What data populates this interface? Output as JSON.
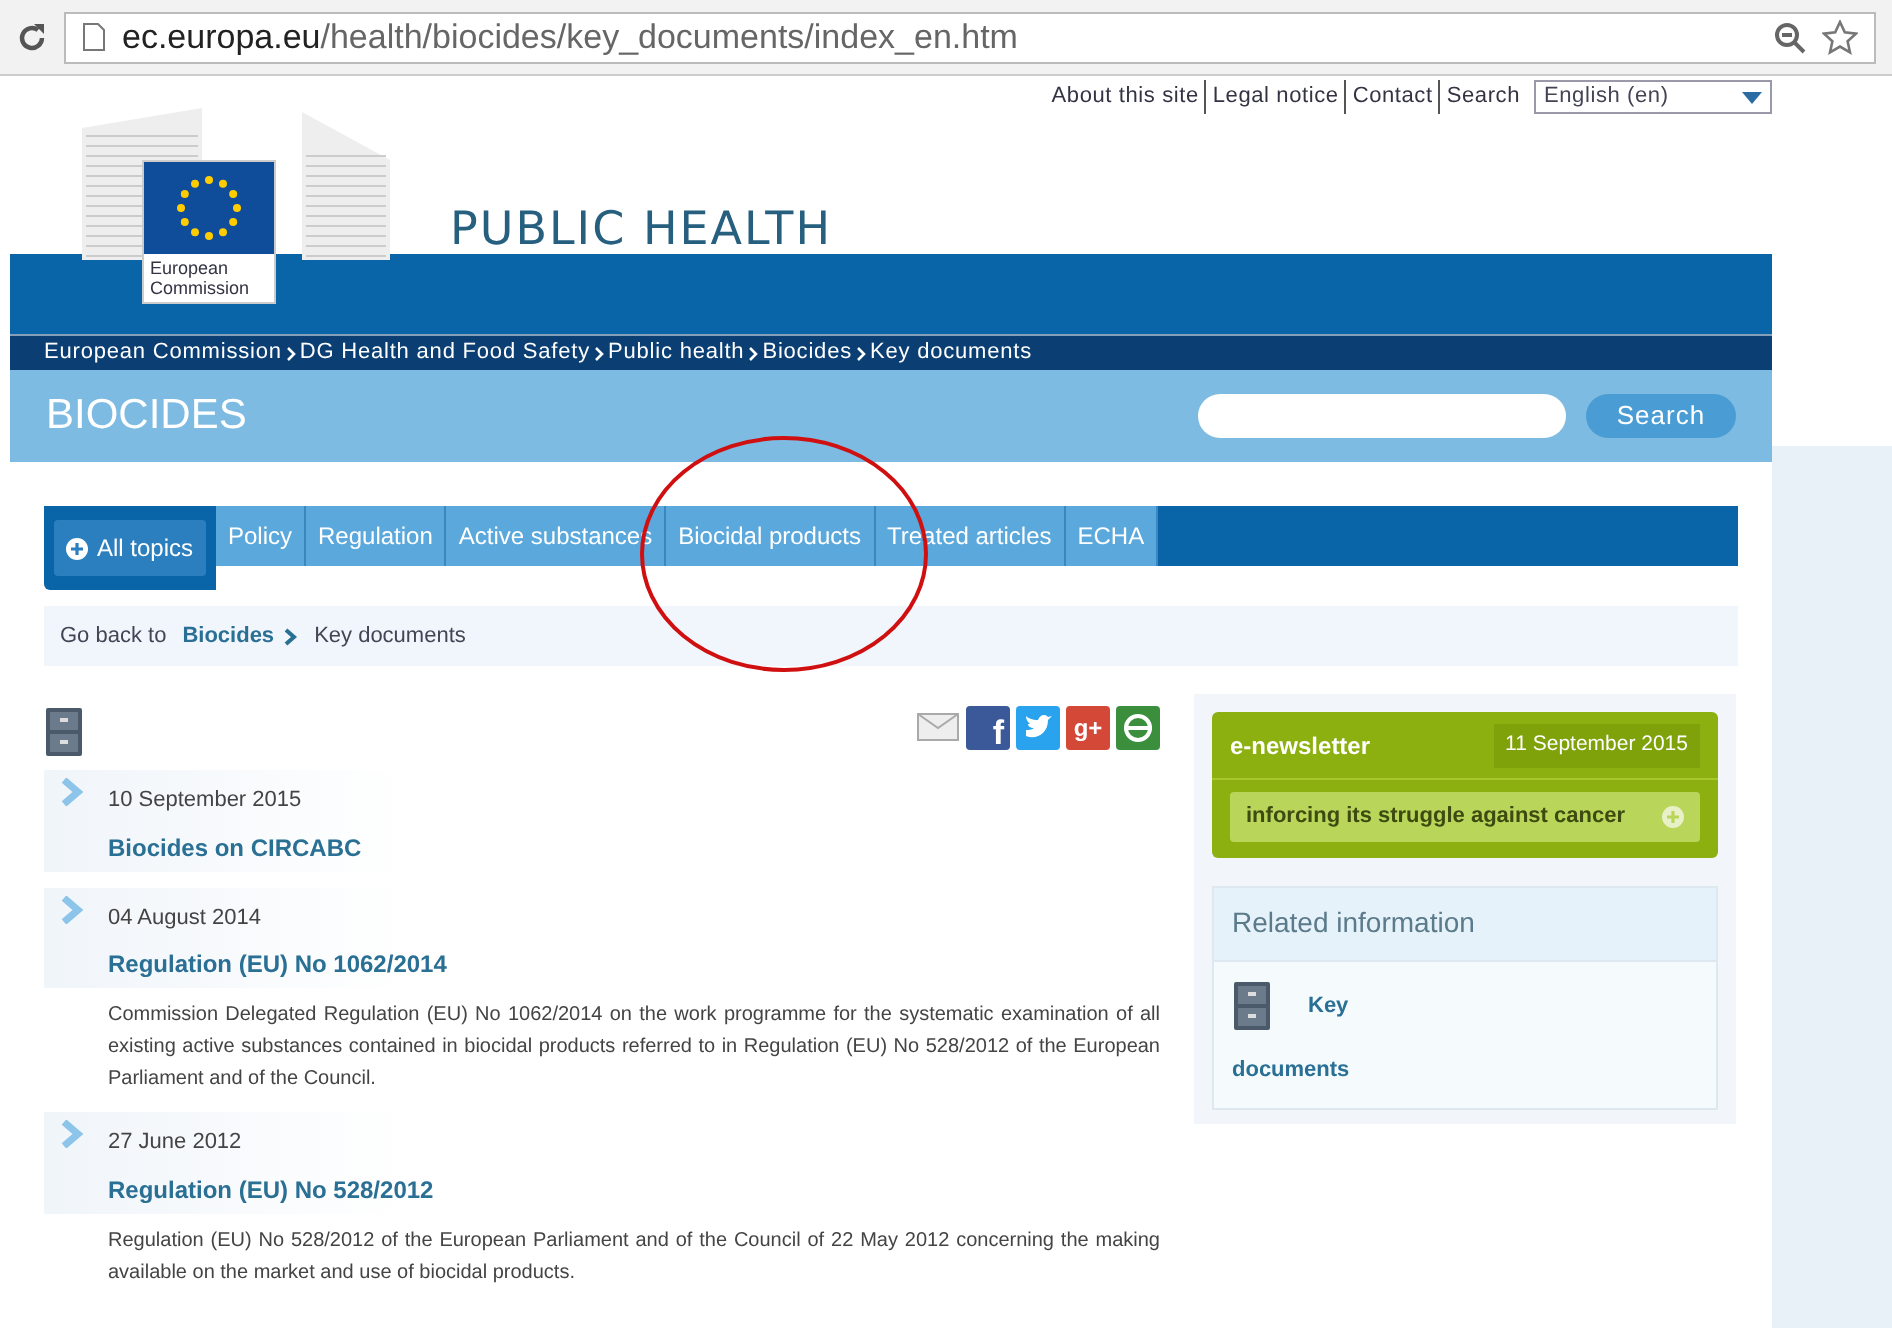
{
  "browser": {
    "url_host": "ec.europa.eu",
    "url_path": "/health/biocides/key_documents/index_en.htm"
  },
  "top_links": [
    "About this site",
    "Legal notice",
    "Contact",
    "Search"
  ],
  "language": {
    "value": "English (en)"
  },
  "logo": {
    "line1": "European",
    "line2": "Commission"
  },
  "site_title": "PUBLIC HEALTH",
  "share_icons": [
    {
      "kind": "email"
    },
    {
      "kind": "facebook",
      "glyph": "f"
    },
    {
      "kind": "twitter"
    },
    {
      "kind": "googleplus",
      "glyph": "g+"
    },
    {
      "kind": "share"
    }
  ],
  "breadcrumb": [
    "European Commission",
    "DG Health and Food Safety",
    "Public health",
    "Biocides",
    "Key documents"
  ],
  "section_title": "BIOCIDES",
  "search_button": "Search",
  "nav": [
    {
      "label": "All topics",
      "kind": "home",
      "selected": false
    },
    {
      "label": "Policy",
      "kind": "tab",
      "selected": false
    },
    {
      "label": "Regulation",
      "kind": "tab",
      "selected": false
    },
    {
      "label": "Active substances",
      "kind": "tab",
      "selected": false
    },
    {
      "label": "Biocidal products",
      "kind": "tab",
      "selected": false
    },
    {
      "label": "Treated articles",
      "kind": "tab",
      "selected": false
    },
    {
      "label": "ECHA",
      "kind": "tab",
      "selected": false
    }
  ],
  "go_back": {
    "prefix": "Go back to",
    "link": "Biocides",
    "current": "Key documents"
  },
  "documents": [
    {
      "date": "10 September 2015",
      "title": "Biocides on CIRCABC"
    },
    {
      "date": "04 August 2014",
      "title": "Regulation (EU) No 1062/2014",
      "summary": "Commission Delegated Regulation (EU) No 1062/2014 on the work programme for the systematic examination of all existing active substances contained in biocidal products referred to in Regulation (EU) No 528/2012 of the European Parliament and of the Council."
    },
    {
      "date": "27 June 2012",
      "title": "Regulation (EU) No 528/2012",
      "summary": "Regulation (EU) No 528/2012 of the European Parliament and of the Council of 22 May 2012 concerning the making available on the market and use of biocidal products."
    }
  ],
  "newsletter": {
    "title": "e-newsletter",
    "date": "11 September 2015",
    "headline": "inforcing its struggle against cancer"
  },
  "related": {
    "title": "Related information",
    "link_word1": "Key",
    "link_word2": "documents"
  }
}
